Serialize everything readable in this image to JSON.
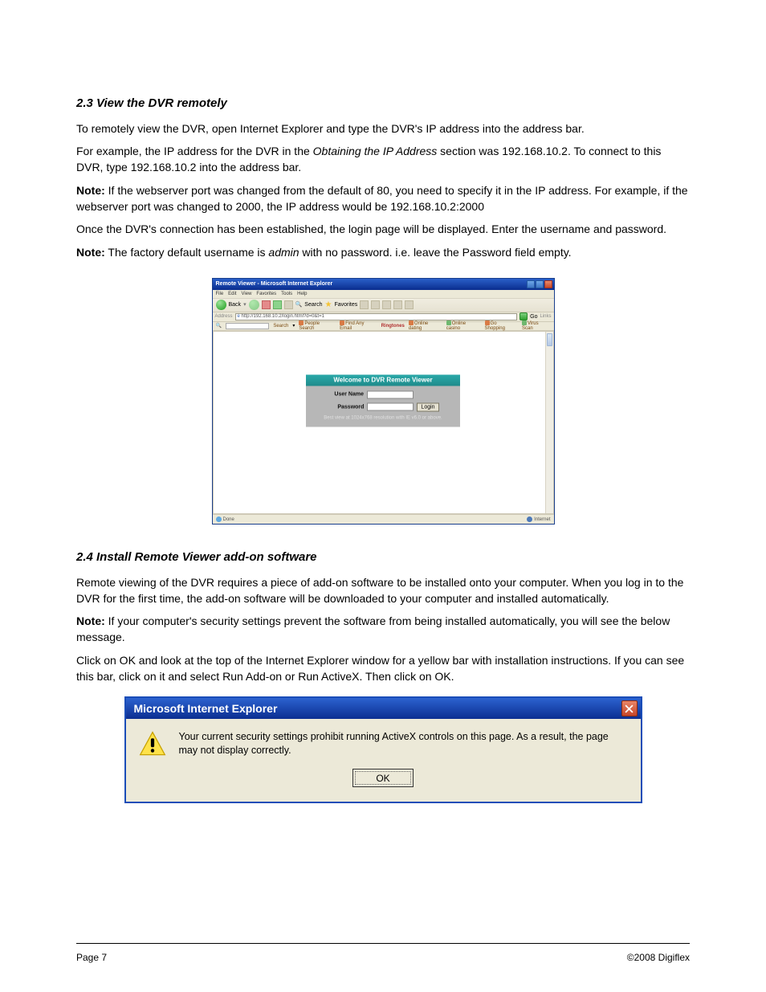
{
  "section1": {
    "heading": "2.3 View the DVR remotely",
    "p1": "To remotely view the DVR, open Internet Explorer and type the DVR's IP address into the address bar.",
    "p2_a": "For example, the IP address for the DVR in the",
    "p2_em": " Obtaining the IP Address ",
    "p2_b": "section was 192.168.10.2. To connect to this DVR, type 192.168.10.2 into the address bar.",
    "p3_a": "Note:",
    "p3_b": " If the webserver port was changed from the default of 80, you need to specify it in the IP address. For example, if the webserver port was changed to 2000, the IP address would be 192.168.10.2:2000",
    "p4": "Once the DVR's connection has been established, the login page will be displayed. Enter the username and password.",
    "p5_a": "Note:",
    "p5_b": " The factory default username is ",
    "p5_admin": "admin",
    "p5_c": " with no password. i.e. leave the Password field empty."
  },
  "screenshot1": {
    "window_title": "Remote Viewer - Microsoft Internet Explorer",
    "menu": [
      "File",
      "Edit",
      "View",
      "Favorites",
      "Tools",
      "Help"
    ],
    "toolbar": {
      "back": "Back",
      "search": "Search",
      "favorites": "Favorites"
    },
    "address_label": "Address",
    "address_url": "http://192.168.10.2/login.html?d=0&t=1",
    "go": "Go",
    "links_label": "Links",
    "linkbar": {
      "search": "Search",
      "people": "People Search",
      "email": "Find Any Email",
      "ring": "Ringtones",
      "dating": "Online dating",
      "casino": "Online casino",
      "shop": "Go Shopping",
      "virus": "Virus Scan"
    },
    "login": {
      "title": "Welcome to DVR Remote Viewer",
      "user_lbl": "User Name",
      "pass_lbl": "Password",
      "login_btn": "Login",
      "note": "Best view at 1024x768 resolution with IE v6.0 or above."
    },
    "status_done": "Done",
    "status_zone": "Internet"
  },
  "section2": {
    "heading": "2.4 Install Remote Viewer add-on software",
    "p1": "Remote viewing of the DVR requires a piece of add-on software to be installed onto your computer. When you log in to the DVR for the first time, the add-on software will be downloaded to your computer and installed automatically.",
    "p2_a": "Note:",
    "p2_b": " If your computer's security settings prevent the software from being installed automatically, you will see the below message.",
    "p3": "Click on OK and look at the top of the Internet Explorer window for a yellow bar with installation instructions. If you can see this bar, click on it and select Run Add-on or Run ActiveX. Then click on OK."
  },
  "dialog": {
    "title": "Microsoft Internet Explorer",
    "message": "Your current security settings prohibit running ActiveX controls on this page.  As a result, the page may not display correctly.",
    "ok": "OK"
  },
  "footer": {
    "left": "Page 7",
    "right": "©2008 Digiflex"
  }
}
